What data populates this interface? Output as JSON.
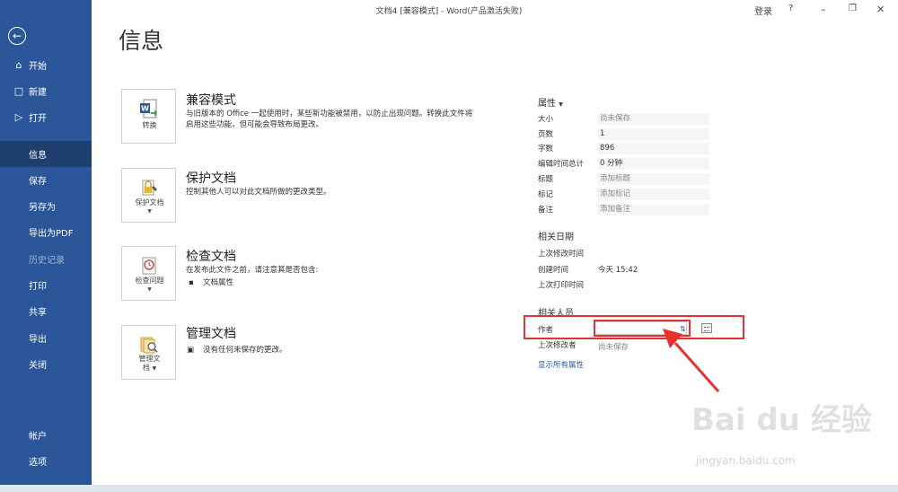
{
  "window": {
    "title": "文档4 [兼容模式]  -  Word(产品激活失败)",
    "signin": "登录",
    "help": "?"
  },
  "sidebar": {
    "back_icon": "back-arrow-icon",
    "items": [
      {
        "label": "开始",
        "icon": "home-icon"
      },
      {
        "label": "新建",
        "icon": "new-document-icon"
      },
      {
        "label": "打开",
        "icon": "open-folder-icon"
      },
      {
        "label": "信息",
        "active": true
      },
      {
        "label": "保存"
      },
      {
        "label": "另存为"
      },
      {
        "label": "导出为PDF"
      },
      {
        "label": "历史记录",
        "disabled": true
      },
      {
        "label": "打印"
      },
      {
        "label": "共享"
      },
      {
        "label": "导出"
      },
      {
        "label": "关闭"
      },
      {
        "label": "帐户"
      },
      {
        "label": "选项"
      }
    ]
  },
  "main": {
    "title": "信息",
    "cards": [
      {
        "button_label": "转换",
        "heading": "兼容模式",
        "desc1": "与旧版本的 Office 一起使用时，某些新功能被禁用，以防止出现问题。转换此文件将",
        "desc2": "启用这些功能，但可能会导致布局更改。"
      },
      {
        "button_label": "保护文档",
        "heading": "保护文档",
        "desc1": "控制其他人可以对此文档所做的更改类型。"
      },
      {
        "button_label": "检查问题",
        "heading": "检查文档",
        "desc1": "在发布此文件之前，请注意其是否包含:",
        "bullet": "文档属性"
      },
      {
        "button_label1": "管理文",
        "button_label2": "档",
        "heading": "管理文档",
        "desc1": "没有任何未保存的更改。"
      }
    ]
  },
  "properties": {
    "heading": "属性",
    "rows": [
      {
        "label": "大小",
        "value": "尚未保存"
      },
      {
        "label": "页数",
        "value": "1"
      },
      {
        "label": "字数",
        "value": "896"
      },
      {
        "label": "编辑时间总计",
        "value": "0 分钟"
      },
      {
        "label": "标题",
        "value": "添加标题"
      },
      {
        "label": "标记",
        "value": "添加标记"
      },
      {
        "label": "备注",
        "value": "添加备注"
      }
    ],
    "dates_heading": "相关日期",
    "dates": [
      {
        "label": "上次修改时间",
        "value": ""
      },
      {
        "label": "创建时间",
        "value": "今天 15:42"
      },
      {
        "label": "上次打印时间",
        "value": ""
      }
    ],
    "people_heading": "相关人员",
    "author_label": "作者",
    "author_value": "",
    "last_modified_by_label": "上次修改者",
    "last_modified_by_value": "尚未保存",
    "show_all": "显示所有属性"
  },
  "watermark": {
    "text": "Bai du 经验",
    "sub": "jingyan.baidu.com"
  },
  "colors": {
    "sidebar": "#2b579a",
    "sidebar_active": "#1e3f6f",
    "highlight": "#e53131"
  }
}
